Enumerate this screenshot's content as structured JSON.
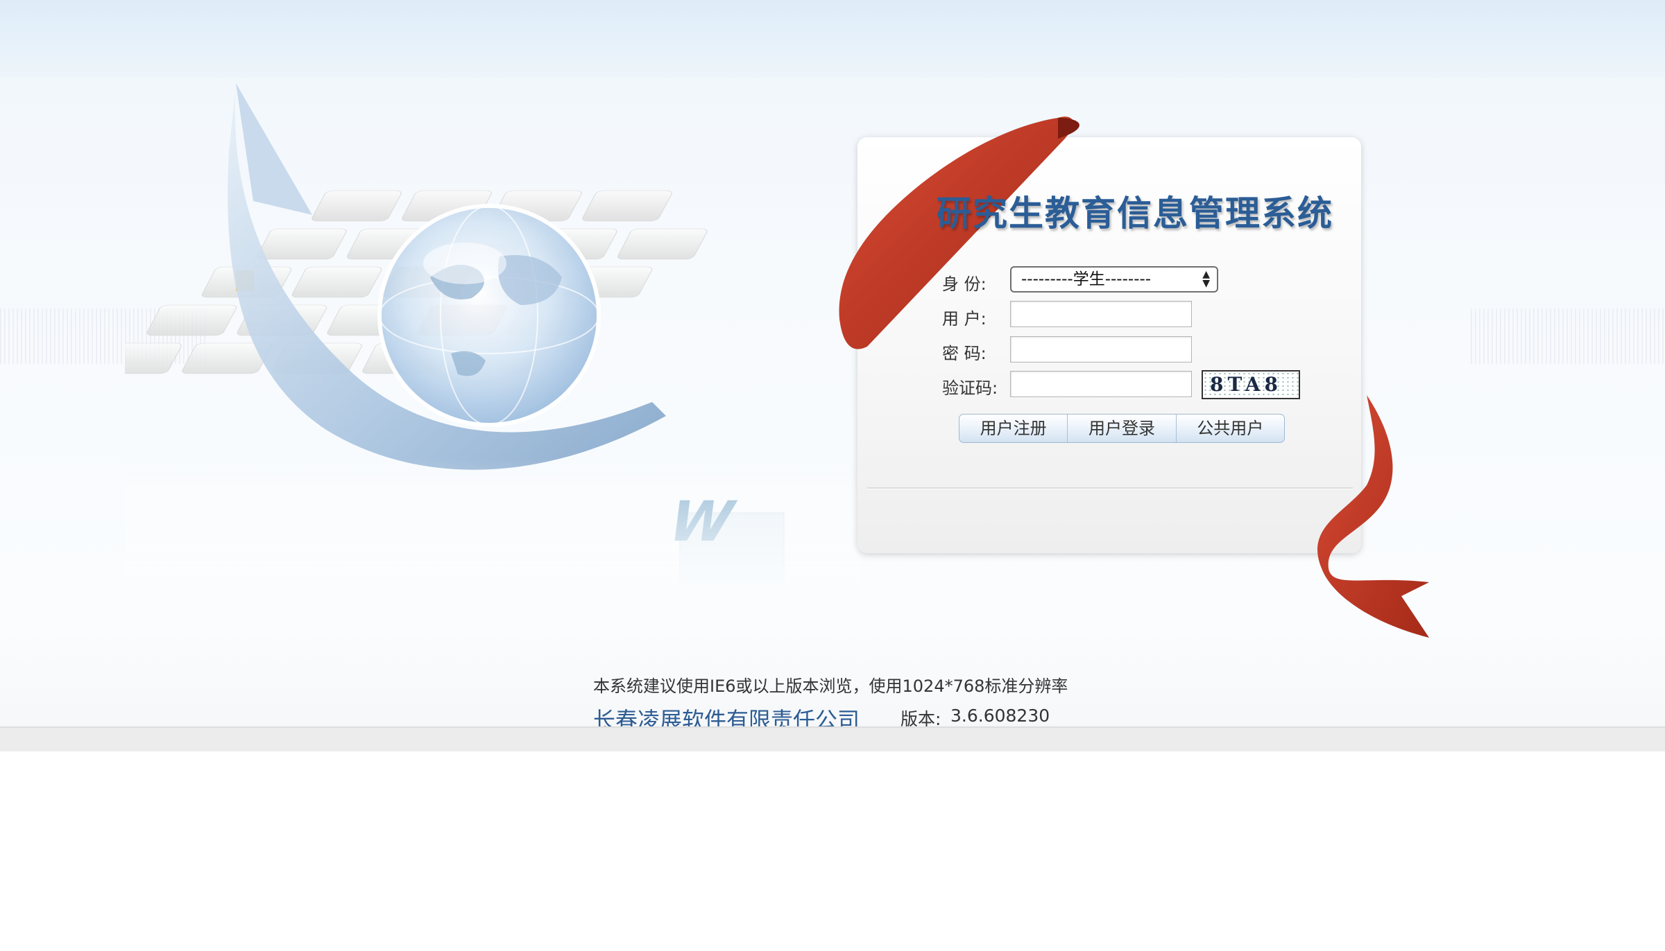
{
  "app": {
    "title": "研究生教育信息管理系统"
  },
  "form": {
    "identity_label": "身  份:",
    "identity_selected": "---------学生--------",
    "username_label": "用  户:",
    "username_value": "",
    "password_label": "密  码:",
    "password_value": "",
    "captcha_label": "验证码:",
    "captcha_value": "",
    "captcha_text": "8TA8"
  },
  "buttons": {
    "register": "用户注册",
    "login": "用户登录",
    "public": "公共用户"
  },
  "footer": {
    "note": "本系统建议使用IE6或以上版本浏览，使用1024*768标准分辨率",
    "company": "长春凌展软件有限责任公司",
    "version_label": "版本:",
    "version_value": "3.6.608230"
  },
  "colors": {
    "title": "#2b5d96",
    "ribbon": "#c0392b",
    "company": "#2d5c93"
  },
  "icons": {
    "decor_arrow": "blue-arrow",
    "decor_globe": "globe",
    "decor_ribbon": "red-ribbon",
    "select_arrow": "updown-arrows"
  }
}
